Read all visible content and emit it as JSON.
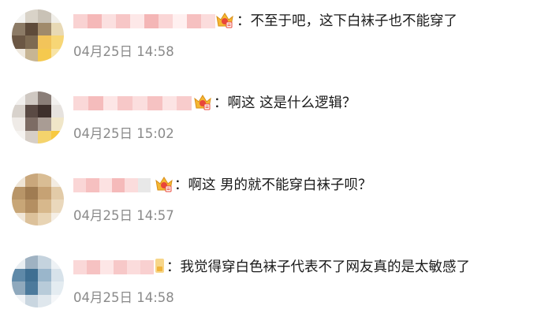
{
  "comments": [
    {
      "text": "：不至于吧，这下白袜子也不能穿了",
      "time": "04月25日 14:58",
      "badge": "crown-icon"
    },
    {
      "text": "：啊这 这是什么逻辑？",
      "time": "04月25日 15:02",
      "badge": "crown-icon"
    },
    {
      "text": "：啊这 男的就不能穿白袜子呗？",
      "time": "04月25日 14:57",
      "badge": "crown-icon"
    },
    {
      "text": "：我觉得穿白色袜子代表不了网友真的是太敏感了",
      "time": "04月25日 14:58",
      "badge": "vip-icon"
    }
  ],
  "colors": {
    "text": "#1a1a1a",
    "time": "#8a8a8a",
    "name_blur": "#f7c4c4",
    "crown_gold": "#f5b731",
    "crown_red": "#e8463a"
  }
}
